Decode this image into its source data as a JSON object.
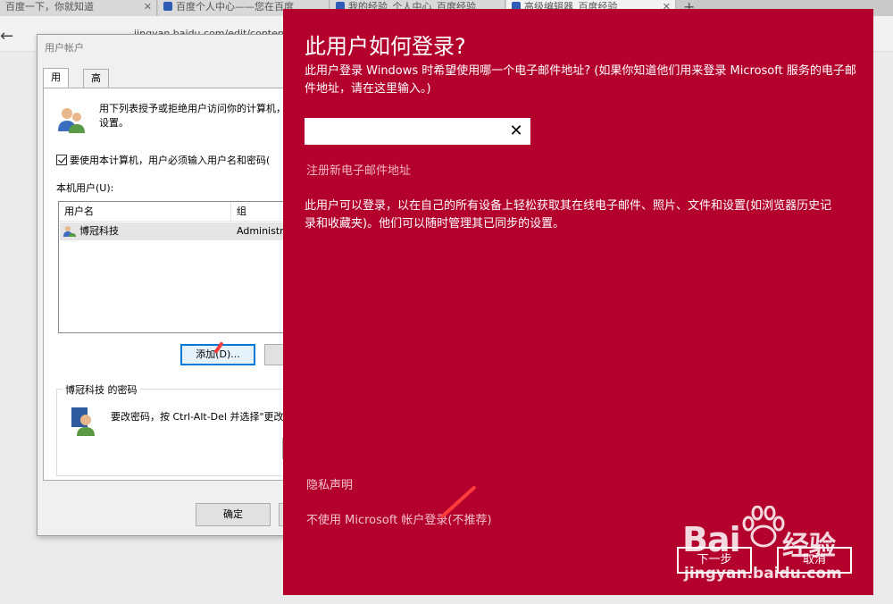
{
  "browser": {
    "tabs": [
      {
        "title": "百度一下，你就知道"
      },
      {
        "title": "百度个人中心——您在百度"
      },
      {
        "title": "我的经验_个人中心_百度经验"
      },
      {
        "title": "高级编辑器_百度经验"
      }
    ],
    "address": "jingyan.baidu.com/edit/content"
  },
  "dialog": {
    "title": "用户帐户",
    "tabs": [
      "用户",
      "高级"
    ],
    "intro": [
      "用下列表授予或拒绝用户访问你的计算机，",
      "设置。"
    ],
    "require_login_label": "要使用本计算机，用户必须输入用户名和密码(",
    "local_users_label": "本机用户(U):",
    "columns": [
      "用户名",
      "组"
    ],
    "rows": [
      {
        "name": "博冠科技",
        "group": "Administrators"
      }
    ],
    "add_button": "添加(D)...",
    "password_group": "博冠科技 的密码",
    "password_text": "要改密码，按 Ctrl-Alt-Del 并选择\"更改密码\"",
    "ok_button": "确定"
  },
  "msa": {
    "title": "此用户如何登录?",
    "desc": "此用户登录 Windows 时希望使用哪一个电子邮件地址? (如果你知道他们用来登录 Microsoft 服务的电子邮件地址，请在这里输入。)",
    "email_value": "",
    "clear_glyph": "✕",
    "signup_link": "注册新电子邮件地址",
    "info": "此用户可以登录，以在自己的所有设备上轻松获取其在线电子邮件、照片、文件和设置(如浏览器历史记录和收藏夹)。他们可以随时管理其已同步的设置。",
    "privacy_link": "隐私声明",
    "no_msa_link": "不使用 Microsoft 帐户登录(不推荐)",
    "next_button": "下一步",
    "cancel_button": "取消",
    "accent_color": "#b4002d"
  },
  "watermark": {
    "bai": "Bai",
    "du": "经验",
    "url": "jingyan.baidu.com"
  }
}
